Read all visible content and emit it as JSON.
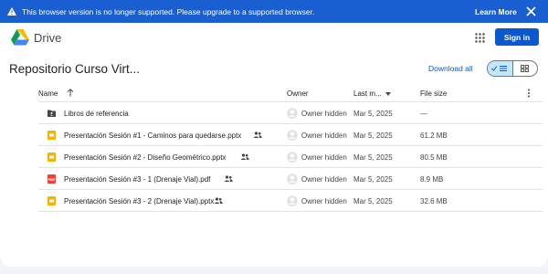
{
  "banner": {
    "message": "This browser version is no longer supported. Please upgrade to a supported browser.",
    "learn_more": "Learn More",
    "bg_color": "#1a5fd1"
  },
  "header": {
    "app_name": "Drive",
    "sign_in": "Sign in"
  },
  "folder": {
    "title": "Repositorio Curso Virt...",
    "download_all": "Download all",
    "view": "list"
  },
  "table": {
    "headers": {
      "name": "Name",
      "owner": "Owner",
      "last_modified": "Last m...",
      "file_size": "File size"
    },
    "rows": [
      {
        "icon": "shared-folder-icon",
        "name": "Libros de referencia",
        "shared": false,
        "owner": "Owner hidden",
        "date": "Mar 5, 2025",
        "size": "—"
      },
      {
        "icon": "slides-icon",
        "name": "Presentación Sesión #1 - Caminos para quedarse.pptx",
        "shared": true,
        "owner": "Owner hidden",
        "date": "Mar 5, 2025",
        "size": "61.2 MB"
      },
      {
        "icon": "slides-icon",
        "name": "Presentación Sesión #2 - Diseño Geométrico.pptx",
        "shared": true,
        "owner": "Owner hidden",
        "date": "Mar 5, 2025",
        "size": "80.5 MB"
      },
      {
        "icon": "pdf-icon",
        "name": "Presentación Sesión #3 - 1 (Drenaje Vial).pdf",
        "shared": true,
        "owner": "Owner hidden",
        "date": "Mar 5, 2025",
        "size": "8.9 MB"
      },
      {
        "icon": "slides-icon",
        "name": "Presentación Sesión #3 - 2 (Drenaje Vial).pptx",
        "shared": true,
        "owner": "Owner hidden",
        "date": "Mar 5, 2025",
        "size": "32.6 MB"
      }
    ]
  }
}
